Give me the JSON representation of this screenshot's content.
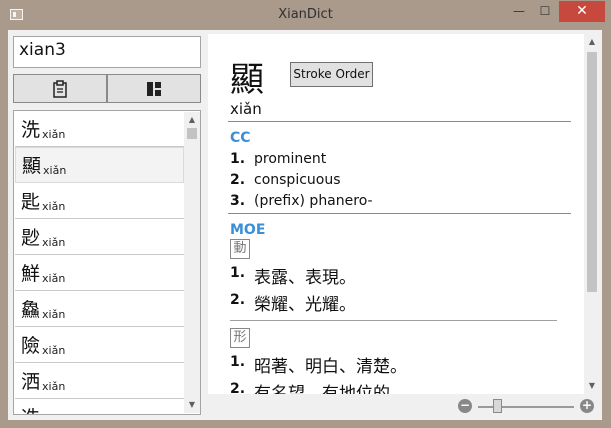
{
  "window": {
    "title": "XianDict",
    "controls": {
      "minimize": "—",
      "maximize": "☐",
      "close": "✕"
    }
  },
  "search": {
    "value": "xian3",
    "placeholder": ""
  },
  "mode_buttons": [
    {
      "icon": "clipboard-icon"
    },
    {
      "icon": "layout-grid-icon"
    }
  ],
  "results": [
    {
      "char": "洗",
      "pinyin": "xiǎn"
    },
    {
      "char": "顯",
      "pinyin": "xiǎn"
    },
    {
      "char": "匙",
      "pinyin": "xiǎn"
    },
    {
      "char": "尟",
      "pinyin": "xiǎn"
    },
    {
      "char": "鮮",
      "pinyin": "xiǎn"
    },
    {
      "char": "鱻",
      "pinyin": "xiǎn"
    },
    {
      "char": "險",
      "pinyin": "xiǎn"
    },
    {
      "char": "洒",
      "pinyin": "xiǎn"
    },
    {
      "char": "冼",
      "pinyin": ""
    }
  ],
  "selected_index": 1,
  "entry": {
    "char": "顯",
    "stroke_order_label": "Stroke Order",
    "pinyin": "xiǎn",
    "cc": {
      "label": "CC",
      "definitions": [
        "prominent",
        "conspicuous",
        "(prefix) phanero-"
      ]
    },
    "moe": {
      "label": "MOE",
      "groups": [
        {
          "pos": "動",
          "definitions": [
            "表露、表現。",
            "榮耀、光耀。"
          ]
        },
        {
          "pos": "形",
          "definitions": [
            "昭著、明白、清楚。",
            "有名望、有地位的。"
          ]
        }
      ]
    }
  },
  "zoom": {
    "minus": "−",
    "plus": "+",
    "level": 0.2
  },
  "scroll": {
    "list_position": 0.0,
    "main_position": 0.0
  }
}
